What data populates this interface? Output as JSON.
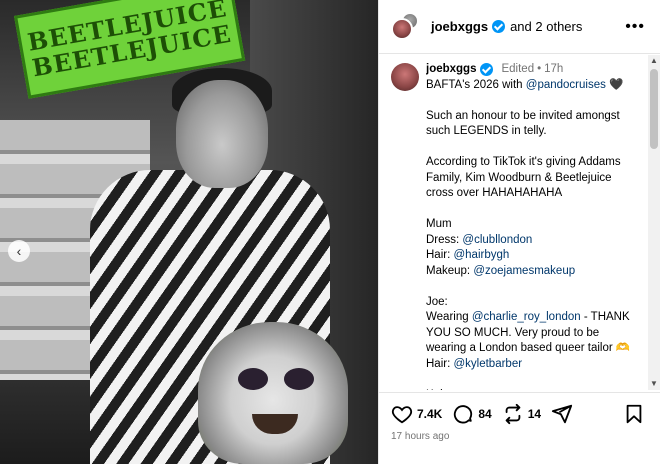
{
  "photo": {
    "sign_line1": "BEETLEJUICE",
    "sign_line2": "BEETLEJUICE",
    "carousel_prev": "‹"
  },
  "header": {
    "username": "joebxggs",
    "others": "and 2 others",
    "more": "•••"
  },
  "caption": {
    "username": "joebxggs",
    "edited": "Edited",
    "dot": "•",
    "age": "17h",
    "lines": [
      {
        "text": "BAFTA's 2026 with ",
        "link": "@pandocruises",
        "after": " 🖤"
      },
      {
        "text": ""
      },
      {
        "text": "Such an honour to be invited amongst"
      },
      {
        "text": "such LEGENDS in telly."
      },
      {
        "text": ""
      },
      {
        "text": "According to TikTok it's giving Addams"
      },
      {
        "text": "Family, Kim Woodburn & Beetlejuice"
      },
      {
        "text": "cross over HAHAHAHAHA"
      },
      {
        "text": ""
      },
      {
        "text": "Mum"
      },
      {
        "text": "Dress: ",
        "link": "@clubllondon"
      },
      {
        "text": "Hair: ",
        "link": "@hairbygh"
      },
      {
        "text": "Makeup: ",
        "link": "@zoejamesmakeup"
      },
      {
        "text": ""
      },
      {
        "text": "Joe:"
      },
      {
        "text": "Wearing ",
        "link": "@charlie_roy_london",
        "after": " - THANK"
      },
      {
        "text": "YOU SO MUCH. Very proud to be"
      },
      {
        "text": "wearing a London based queer tailor 🫶"
      },
      {
        "text": "Hair: ",
        "link": "@kyletbarber"
      },
      {
        "text": ""
      },
      {
        "text": "Kaine"
      }
    ]
  },
  "actions": {
    "likes": "7.4K",
    "comments": "84",
    "reposts": "14",
    "timestamp": "17 hours ago"
  },
  "colors": {
    "verified": "#0095f6",
    "link": "#00376b",
    "muted": "#737373"
  }
}
